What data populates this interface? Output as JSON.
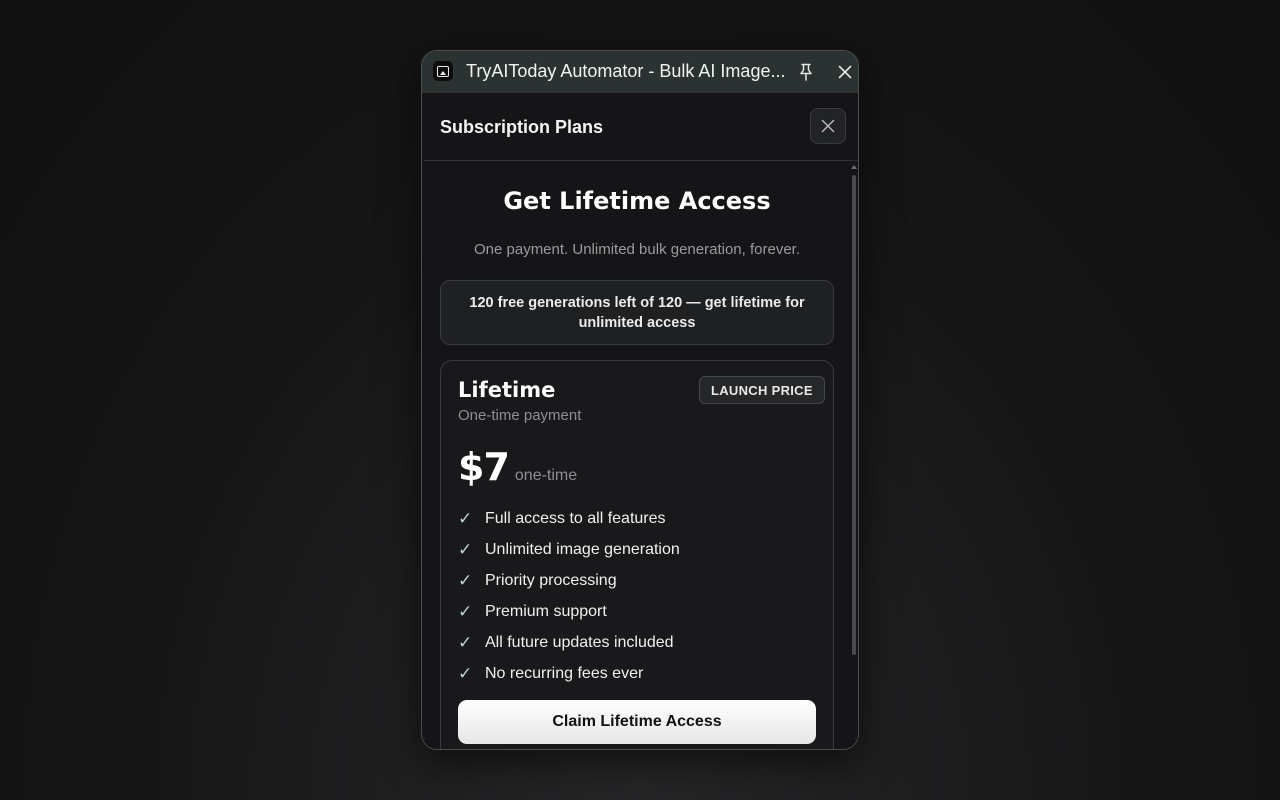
{
  "window": {
    "title": "TryAIToday Automator - Bulk AI Image..."
  },
  "dialog": {
    "title": "Subscription Plans"
  },
  "hero": {
    "title": "Get Lifetime Access",
    "subtitle": "One payment. Unlimited bulk generation, forever."
  },
  "banner": {
    "text": "120 free generations left of 120 — get lifetime for unlimited access"
  },
  "plan": {
    "name": "Lifetime",
    "description": "One-time payment",
    "badge": "LAUNCH PRICE",
    "price": "$7",
    "price_unit": "one-time",
    "features": [
      "Full access to all features",
      "Unlimited image generation",
      "Priority processing",
      "Premium support",
      "All future updates included",
      "No recurring fees ever"
    ],
    "cta_label": "Claim Lifetime Access"
  },
  "colors": {
    "accent_check": "#b9d6cf",
    "titlebar": "#2b3232",
    "panel_bg": "#151517"
  },
  "icons": {
    "app": "app-image-icon",
    "pin": "pin-icon",
    "close": "close-icon",
    "check": "check-icon"
  }
}
